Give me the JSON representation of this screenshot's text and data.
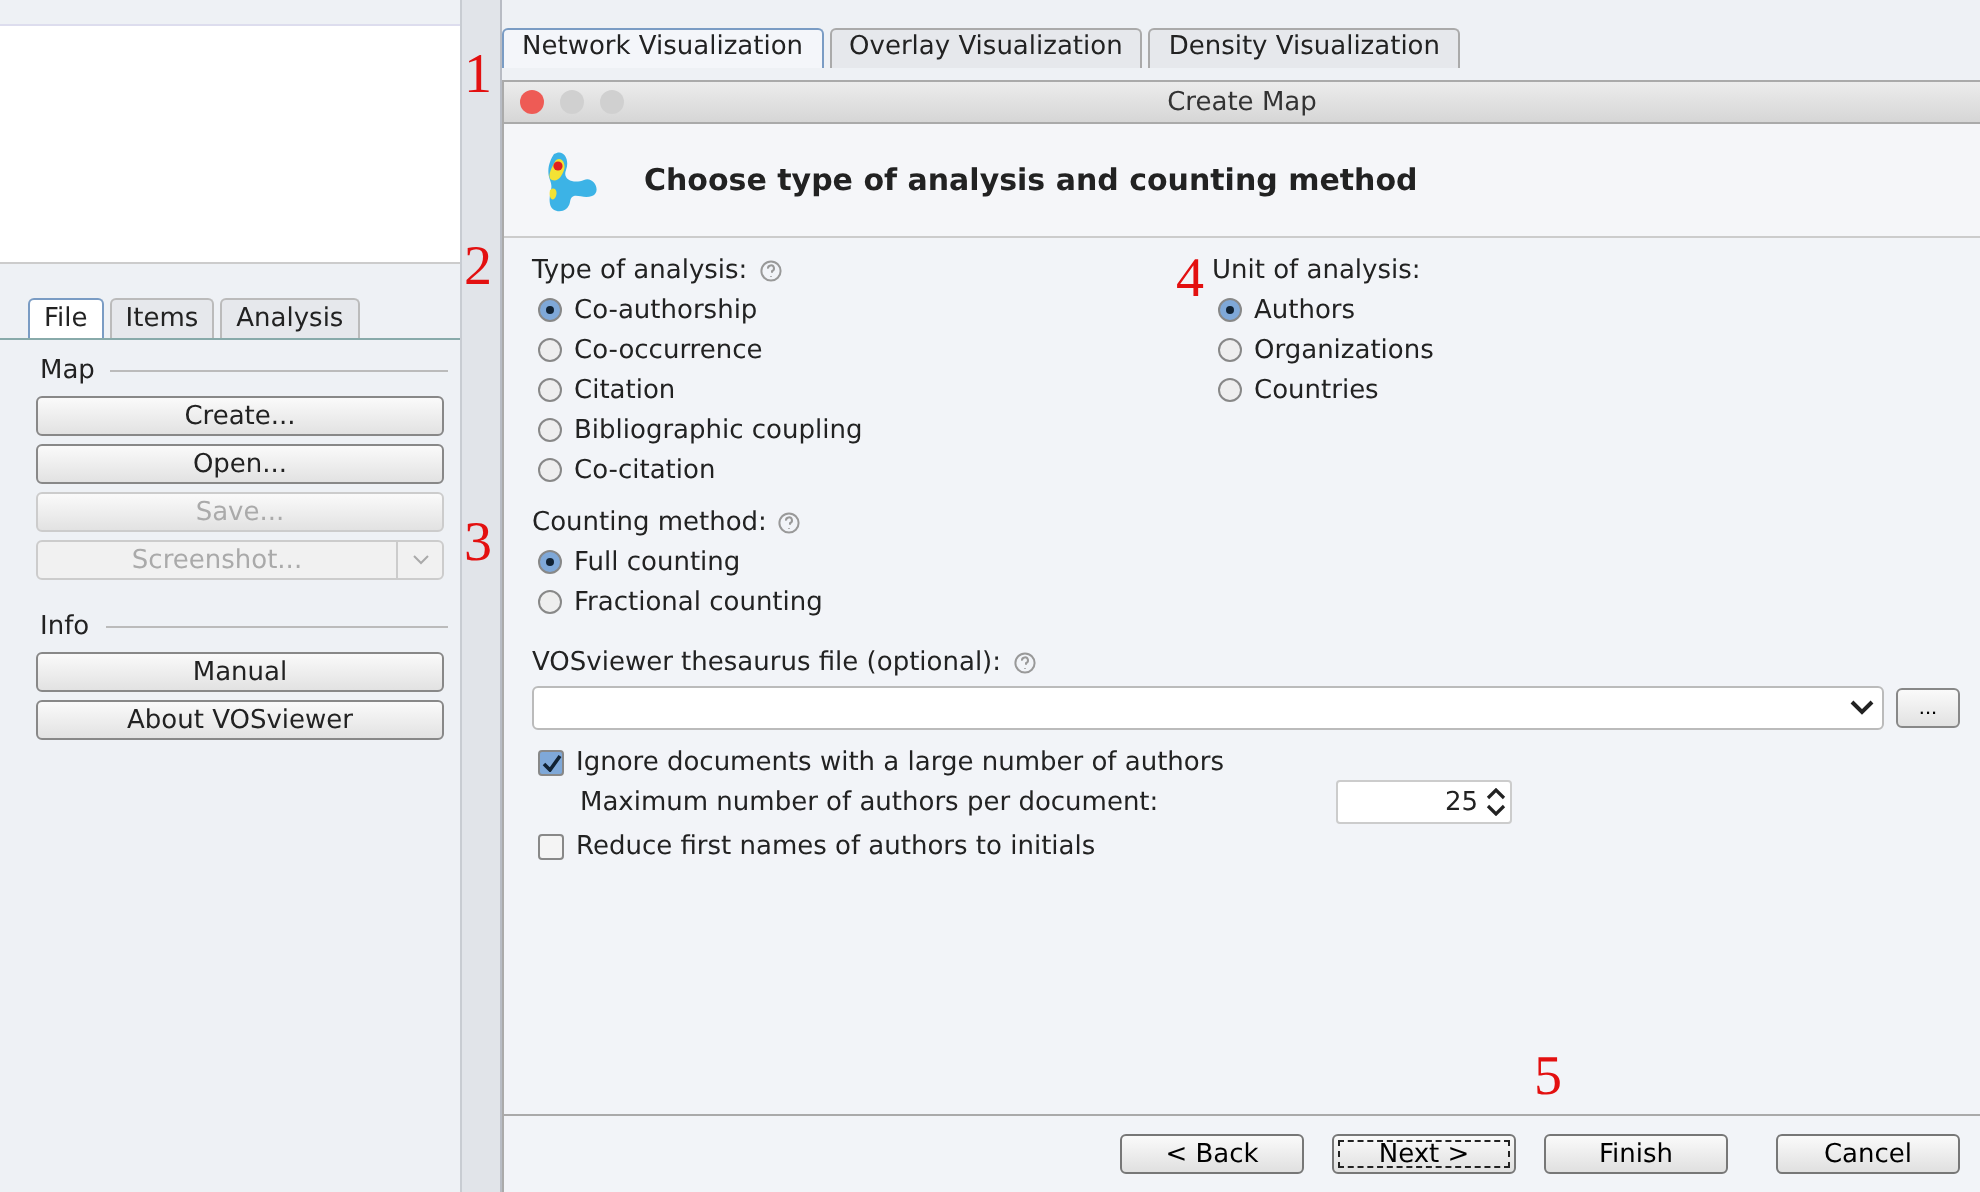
{
  "annotations": [
    "1",
    "2",
    "3",
    "4",
    "5"
  ],
  "sidebar": {
    "tabs": [
      {
        "label": "File",
        "selected": true
      },
      {
        "label": "Items",
        "selected": false
      },
      {
        "label": "Analysis",
        "selected": false
      }
    ],
    "sections": [
      {
        "title": "Map",
        "buttons": [
          {
            "label": "Create...",
            "disabled": false,
            "kind": "plain"
          },
          {
            "label": "Open...",
            "disabled": false,
            "kind": "plain"
          },
          {
            "label": "Save...",
            "disabled": true,
            "kind": "plain"
          },
          {
            "label": "Screenshot...",
            "disabled": true,
            "kind": "split"
          }
        ]
      },
      {
        "title": "Info",
        "buttons": [
          {
            "label": "Manual",
            "disabled": false,
            "kind": "plain"
          },
          {
            "label": "About VOSviewer",
            "disabled": false,
            "kind": "plain"
          }
        ]
      }
    ]
  },
  "view_tabs": [
    {
      "label": "Network Visualization",
      "selected": true
    },
    {
      "label": "Overlay Visualization",
      "selected": false
    },
    {
      "label": "Density Visualization",
      "selected": false
    }
  ],
  "dialog": {
    "title": "Create Map",
    "heading": "Choose type of analysis and counting method",
    "type_of_analysis": {
      "label": "Type of analysis:",
      "options": [
        {
          "label": "Co-authorship",
          "selected": true
        },
        {
          "label": "Co-occurrence",
          "selected": false
        },
        {
          "label": "Citation",
          "selected": false
        },
        {
          "label": "Bibliographic coupling",
          "selected": false
        },
        {
          "label": "Co-citation",
          "selected": false
        }
      ]
    },
    "unit_of_analysis": {
      "label": "Unit of analysis:",
      "options": [
        {
          "label": "Authors",
          "selected": true
        },
        {
          "label": "Organizations",
          "selected": false
        },
        {
          "label": "Countries",
          "selected": false
        }
      ]
    },
    "counting_method": {
      "label": "Counting method:",
      "options": [
        {
          "label": "Full counting",
          "selected": true
        },
        {
          "label": "Fractional counting",
          "selected": false
        }
      ]
    },
    "thesaurus": {
      "label": "VOSviewer thesaurus file (optional):",
      "browse": "..."
    },
    "ignore_large": {
      "label": "Ignore documents with a large number of authors",
      "checked": true
    },
    "max_authors": {
      "label": "Maximum number of authors per document:",
      "value": "25"
    },
    "reduce_names": {
      "label": "Reduce first names of authors to initials",
      "checked": false
    },
    "buttons": [
      {
        "label": "< Back",
        "focused": false
      },
      {
        "label": "Next >",
        "focused": true
      },
      {
        "label": "Finish",
        "focused": false
      },
      {
        "label": "Cancel",
        "focused": false
      }
    ]
  }
}
